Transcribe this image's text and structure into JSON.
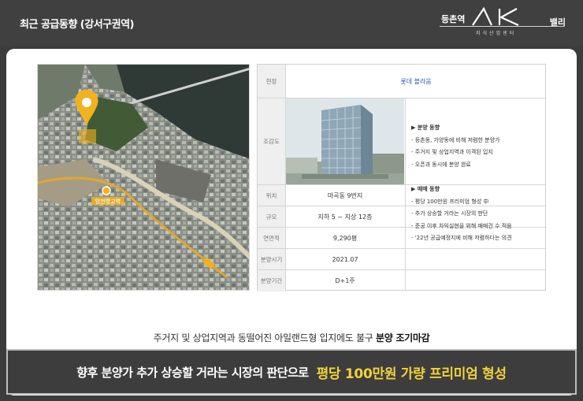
{
  "header": {
    "title": "최근 공급동향 (강서구권역)",
    "brand_left": "등촌역",
    "brand_right": "밸리",
    "brand_sub": "지식산업센터",
    "brand_mark": "AK"
  },
  "map": {
    "station_label": "양천향교역"
  },
  "table": {
    "site_label": "현장",
    "site_value": "롯데 블라움",
    "rendering_label": "조감도",
    "rows": [
      {
        "label": "위치",
        "value": "마곡동 9번지"
      },
      {
        "label": "규모",
        "value": "지하 5 ~ 지상 12층"
      },
      {
        "label": "연면적",
        "value": "9,290평"
      },
      {
        "label": "분양시기",
        "value": "2021.07"
      },
      {
        "label": "분양기간",
        "value": "D+1주"
      }
    ],
    "notes": {
      "sale_trend_title": "▶ 분양 동향",
      "sale_trend_items": [
        "- 등촌동, 가양동에 비해 저렴한 분양가",
        "- 주거지 및 상업지역과 이격된 입지",
        "- 오픈과 동시에 분양 완료"
      ],
      "trade_trend_title": "▶ 매매 동향",
      "trade_trend_items": [
        "- 평당 100만원 프리미엄 형성 中",
        "- 추가 상승할 거라는 시장의 판단",
        "- 준공 이후 차익실현을 위해 매매건 수 적음",
        "- '22년 공급예정지에 비해 저렴하다는 의견"
      ]
    }
  },
  "summary": {
    "text": "주거지 및 상업지역과 동떨어진 아일랜드형 입지에도 불구",
    "emphasis": "분양 조기마감"
  },
  "banner": {
    "text": "향후 분양가 추가 상승할 거라는 시장의 판단으로",
    "highlight": "평당 100만원 가량 프리미엄 형성"
  },
  "colors": {
    "header_bg": "#404040",
    "accent_gold": "#f3d23a",
    "link_blue": "#2d5db8",
    "pin_yellow": "#f2b21b"
  }
}
